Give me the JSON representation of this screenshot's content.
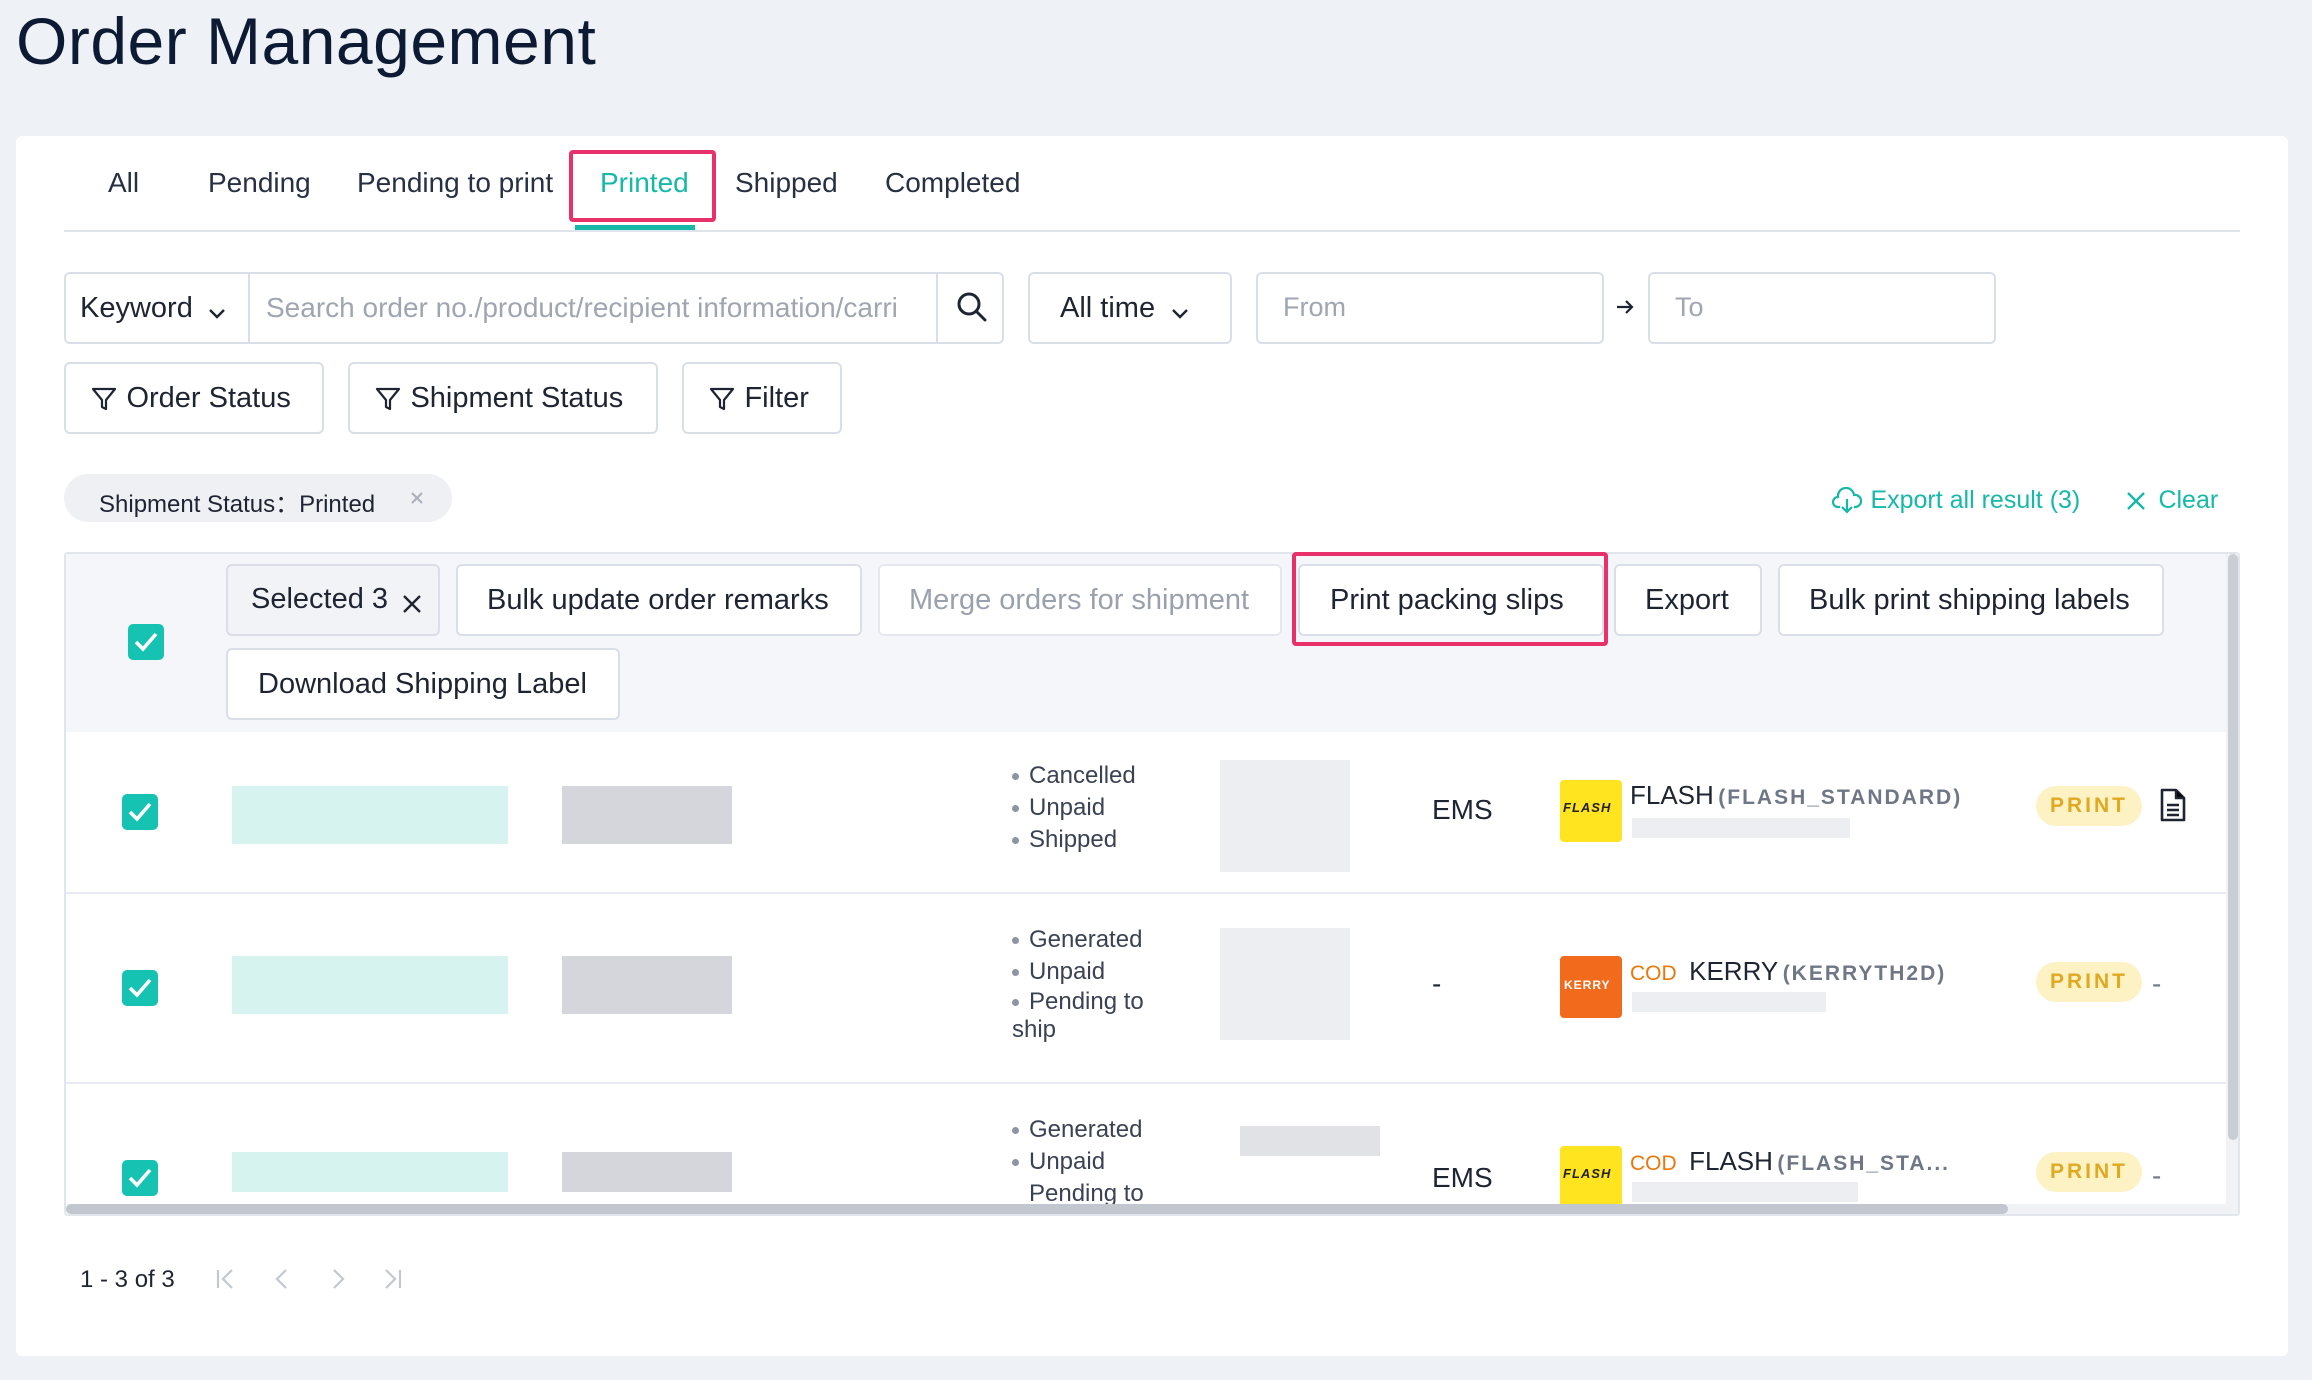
{
  "title": "Order Management",
  "tabs": [
    {
      "label": "All"
    },
    {
      "label": "Pending"
    },
    {
      "label": "Pending to print"
    },
    {
      "label": "Printed"
    },
    {
      "label": "Shipped"
    },
    {
      "label": "Completed"
    }
  ],
  "search": {
    "keyword_label": "Keyword",
    "placeholder": "Search order no./product/recipient information/carri",
    "time_label": "All time",
    "from_placeholder": "From",
    "to_placeholder": "To"
  },
  "filters": {
    "order_status": "Order Status",
    "shipment_status": "Shipment Status",
    "filter": "Filter"
  },
  "active_filter": {
    "label": "Shipment Status：Printed"
  },
  "actions": {
    "export_all": "Export all result (3)",
    "clear": "Clear"
  },
  "bulk": {
    "selected": "Selected 3",
    "update_remarks": "Bulk update order remarks",
    "merge": "Merge orders for shipment",
    "print_packing": "Print packing slips",
    "export": "Export",
    "bulk_print": "Bulk print shipping labels",
    "download": "Download Shipping Label"
  },
  "rows": [
    {
      "statuses": [
        "Cancelled",
        "Unpaid",
        "Shipped"
      ],
      "service": "EMS",
      "carrier": "FLASH",
      "carrier_code": "(FLASH_STANDARD)",
      "cod": "",
      "badge": "PRINT",
      "extra": ""
    },
    {
      "statuses": [
        "Generated",
        "Unpaid",
        "Pending to ship"
      ],
      "service": "-",
      "carrier": "KERRY",
      "carrier_code": "(KERRYTH2D)",
      "cod": "COD",
      "badge": "PRINT",
      "extra": "-"
    },
    {
      "statuses": [
        "Generated",
        "Unpaid",
        "Pending to"
      ],
      "service": "EMS",
      "carrier": "FLASH",
      "carrier_code": "(FLASH_STA...",
      "cod": "COD",
      "badge": "PRINT",
      "extra": "-"
    }
  ],
  "logos": {
    "flash": "FLASH",
    "kerry": "KERRY"
  },
  "pagination": {
    "summary": "1 - 3 of 3"
  },
  "colors": {
    "accent": "#16b8a8",
    "highlight": "#e8306a",
    "flash_logo": "#ffe41f",
    "kerry_logo": "#f26b1d"
  }
}
